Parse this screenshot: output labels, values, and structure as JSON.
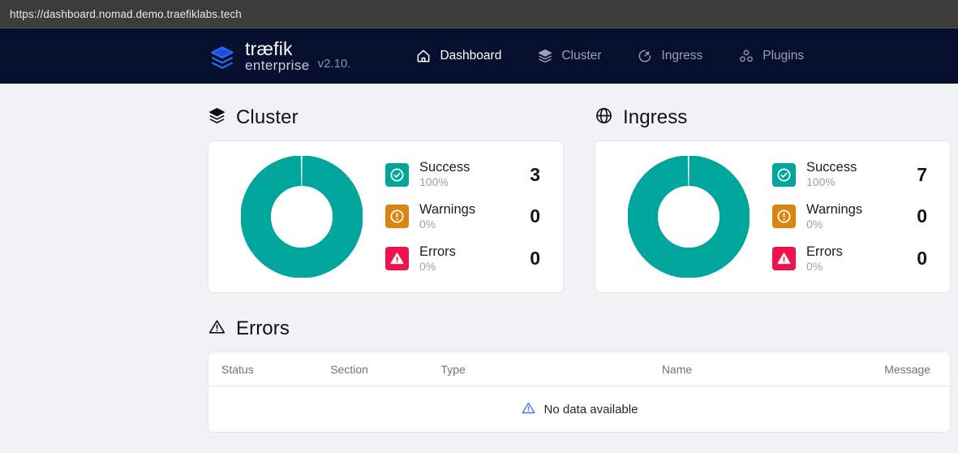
{
  "browser": {
    "url": "https://dashboard.nomad.demo.traefiklabs.tech"
  },
  "navbar": {
    "brand_line1": "træfik",
    "brand_line2": "enterprise",
    "version": "v2.10.",
    "logo_icon": "traefik-logo-icon",
    "items": [
      {
        "label": "Dashboard",
        "icon": "home-icon",
        "active": true
      },
      {
        "label": "Cluster",
        "icon": "layers-icon",
        "active": false
      },
      {
        "label": "Ingress",
        "icon": "gauge-icon",
        "active": false
      },
      {
        "label": "Plugins",
        "icon": "blocks-icon",
        "active": false
      }
    ]
  },
  "colors": {
    "navbar_bg": "#06102e",
    "page_bg": "#f0f2f4",
    "success": "#00a69b",
    "warning": "#d98512",
    "error": "#f0124f",
    "brand_blue": "#2a6df4",
    "info_blue": "#4a7bf7"
  },
  "sections": {
    "cluster": {
      "title": "Cluster",
      "icon": "layers-icon",
      "stats": [
        {
          "label": "Success",
          "percent": "100%",
          "value": "3",
          "icon": "check-circle-icon",
          "color": "#00a69b"
        },
        {
          "label": "Warnings",
          "percent": "0%",
          "value": "0",
          "icon": "exclamation-circle-icon",
          "color": "#d98512"
        },
        {
          "label": "Errors",
          "percent": "0%",
          "value": "0",
          "icon": "warning-triangle-icon",
          "color": "#f0124f"
        }
      ],
      "chart_data": {
        "type": "pie",
        "title": "Cluster status",
        "categories": [
          "Success",
          "Warnings",
          "Errors"
        ],
        "values": [
          3,
          0,
          0
        ],
        "percents": [
          100,
          0,
          0
        ],
        "colors": [
          "#00a69b",
          "#d98512",
          "#f0124f"
        ],
        "donut": true,
        "legend": "right"
      }
    },
    "ingress": {
      "title": "Ingress",
      "icon": "globe-icon",
      "stats": [
        {
          "label": "Success",
          "percent": "100%",
          "value": "7",
          "icon": "check-circle-icon",
          "color": "#00a69b"
        },
        {
          "label": "Warnings",
          "percent": "0%",
          "value": "0",
          "icon": "exclamation-circle-icon",
          "color": "#d98512"
        },
        {
          "label": "Errors",
          "percent": "0%",
          "value": "0",
          "icon": "warning-triangle-icon",
          "color": "#f0124f"
        }
      ],
      "chart_data": {
        "type": "pie",
        "title": "Ingress status",
        "categories": [
          "Success",
          "Warnings",
          "Errors"
        ],
        "values": [
          7,
          0,
          0
        ],
        "percents": [
          100,
          0,
          0
        ],
        "colors": [
          "#00a69b",
          "#d98512",
          "#f0124f"
        ],
        "donut": true,
        "legend": "right"
      }
    },
    "errors": {
      "title": "Errors",
      "icon": "warning-triangle-icon",
      "columns": [
        "Status",
        "Section",
        "Type",
        "Name",
        "Message"
      ],
      "empty_message": "No data available",
      "empty_icon": "warning-triangle-icon",
      "rows": []
    }
  }
}
